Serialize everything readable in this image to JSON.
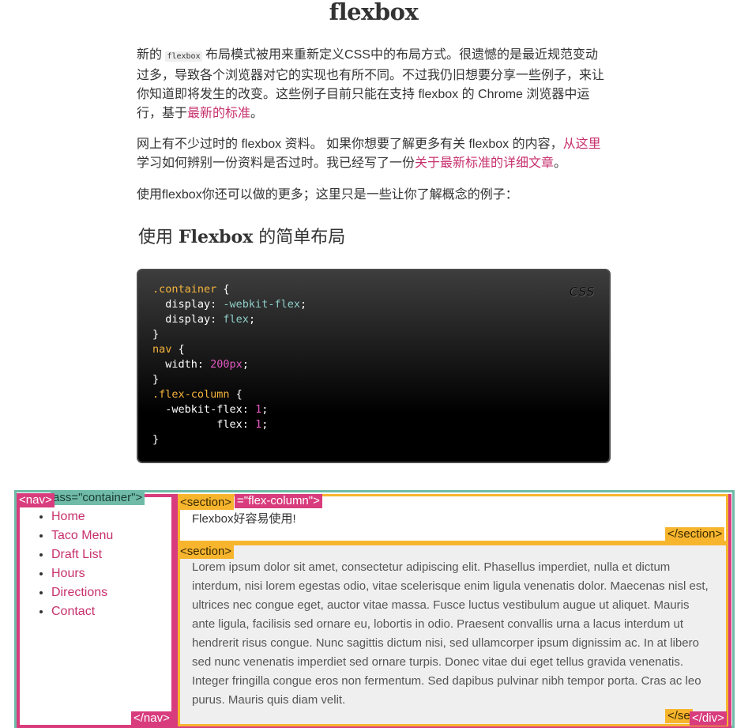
{
  "page": {
    "title": "flexbox",
    "p1": {
      "t1": "新的 ",
      "code": "flexbox",
      "t2": " 布局模式被用来重新定义CSS中的布局方式。很遗憾的是最近规范变动过多，导致各个浏览器对它的实现也有所不同。不过我仍旧想要分享一些例子，来让你知道即将发生的改变。这些例子目前只能在支持 flexbox 的 Chrome 浏览器中运行，基于",
      "link": "最新的标准",
      "t3": "。"
    },
    "p2": {
      "t1": "网上有不少过时的 flexbox 资料。 如果你想要了解更多有关 flexbox 的内容，",
      "link1": "从这里",
      "t2": "学习如何辨别一份资料是否过时。我已经写了一份",
      "link2": "关于最新标准的详细文章",
      "t3": "。"
    },
    "p3": "使用flexbox你还可以做的更多；这里只是一些让你了解概念的例子：",
    "h2": {
      "pre": "使用 ",
      "bold": "Flexbox",
      "post": " 的简单布局"
    }
  },
  "code": {
    "language": "CSS",
    "l1_sel": ".container",
    "l1_brace": " {",
    "l2_prop": "  display",
    "l2_val": "-webkit-flex",
    "l3_prop": "  display",
    "l3_val": "flex",
    "l4": "}",
    "l5_sel": "nav",
    "l5_brace": " {",
    "l6_prop": "  width",
    "l6_val": "200px",
    "l7": "}",
    "l8_sel": ".flex-column",
    "l8_brace": " {",
    "l9_prop": "  -webkit-flex",
    "l9_val": "1",
    "l10_prop": "          flex",
    "l10_val": "1",
    "l11": "}"
  },
  "demo": {
    "tag_container": "ass=\"container\">",
    "tag_nav_open": "<nav>",
    "tag_nav_close": "</nav>",
    "tag_flexcol": "=\"flex-column\">",
    "tag_section_open": "<section>",
    "tag_section_close": "</section>",
    "tag_section_close_clipped": "</se",
    "tag_div_close": "</div>",
    "nav_items": [
      "Home",
      "Taco Menu",
      "Draft List",
      "Hours",
      "Directions",
      "Contact"
    ],
    "section1_text": "Flexbox好容易使用!",
    "section2_text": "Lorem ipsum dolor sit amet, consectetur adipiscing elit. Phasellus imperdiet, nulla et dictum interdum, nisi lorem egestas odio, vitae scelerisque enim ligula venenatis dolor. Maecenas nisl est, ultrices nec congue eget, auctor vitae massa. Fusce luctus vestibulum augue ut aliquet. Mauris ante ligula, facilisis sed ornare eu, lobortis in odio. Praesent convallis urna a lacus interdum ut hendrerit risus congue. Nunc sagittis dictum nisi, sed ullamcorper ipsum dignissim ac. In at libero sed nunc venenatis imperdiet sed ornare turpis. Donec vitae dui eget tellus gravida venenatis. Integer fringilla congue eros non fermentum. Sed dapibus pulvinar nibh tempor porta. Cras ac leo purus. Mauris quis diam velit."
  },
  "colors": {
    "link": "#c7306d",
    "container_outline": "#6fbba8",
    "nav_outline": "#d83c7d",
    "section_outline": "#f7b52e"
  }
}
